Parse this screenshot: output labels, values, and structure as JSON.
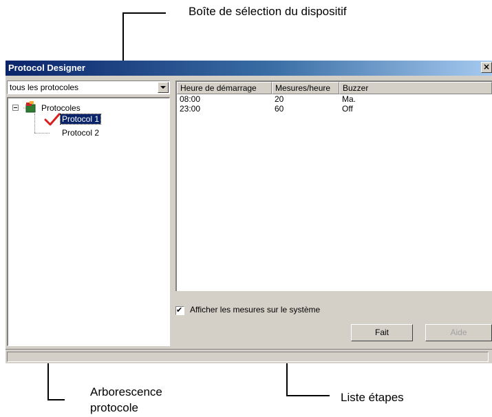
{
  "callouts": {
    "device_selector": "Boîte de sélection du dispositif",
    "protocol_tree_line1": "Arborescence",
    "protocol_tree_line2": "protocole",
    "step_list": "Liste étapes"
  },
  "window": {
    "title": "Protocol Designer",
    "close_glyph": "×"
  },
  "device_select": {
    "value": "tous les protocoles"
  },
  "tree": {
    "root": "Protocoles",
    "items": [
      "Protocol 1",
      "Protocol 2"
    ]
  },
  "step_list": {
    "columns": [
      "Heure de démarrage",
      "Mesures/heure",
      "Buzzer"
    ],
    "rows": [
      [
        "08:00",
        "20",
        "Ma."
      ],
      [
        "23:00",
        "60",
        "Off"
      ]
    ]
  },
  "options": {
    "show_measurements_label": "Afficher les mesures sur le système",
    "show_measurements_checked": "✔"
  },
  "buttons": {
    "done": "Fait",
    "help": "Aide"
  },
  "colors": {
    "titlebar_start": "#0a246a",
    "titlebar_end": "#a6caf0",
    "face": "#d4d0c8",
    "check_red": "#d81e1e"
  }
}
